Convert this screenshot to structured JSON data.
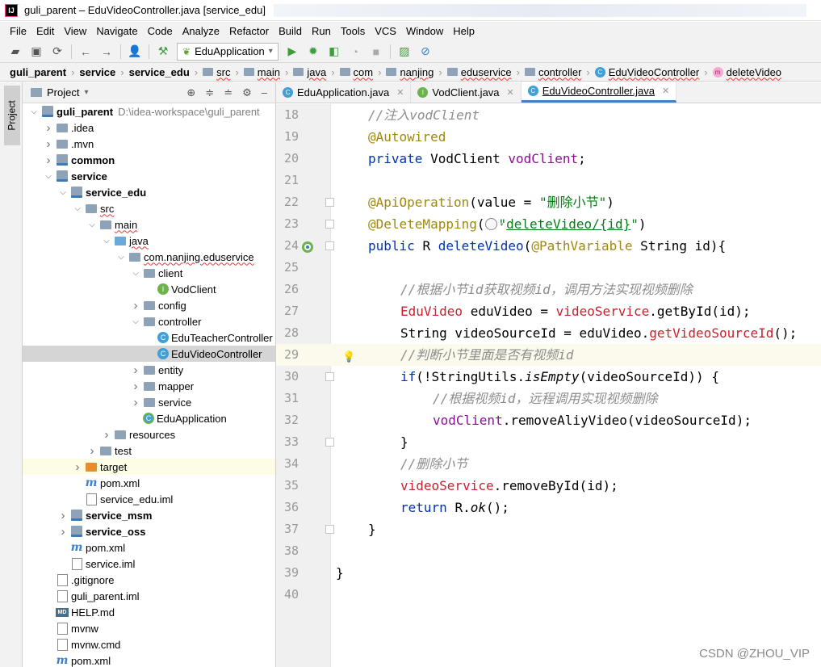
{
  "window": {
    "title": "guli_parent – EduVideoController.java [service_edu]",
    "app_icon": "IJ"
  },
  "menu": [
    "File",
    "Edit",
    "View",
    "Navigate",
    "Code",
    "Analyze",
    "Refactor",
    "Build",
    "Run",
    "Tools",
    "VCS",
    "Window",
    "Help"
  ],
  "toolbar": {
    "run_config": "EduApplication",
    "icons": [
      "open-folder-icon",
      "save-icon",
      "sync-icon",
      "back-icon",
      "forward-icon",
      "user-icon",
      "build-hammer-icon",
      "run-icon",
      "debug-icon",
      "coverage-icon",
      "profile-icon",
      "stop-icon",
      "monitor-icon",
      "no-entry-icon"
    ]
  },
  "breadcrumb": [
    {
      "label": "guli_parent",
      "bold": true
    },
    {
      "label": "service",
      "bold": true
    },
    {
      "label": "service_edu",
      "bold": true
    },
    {
      "label": "src"
    },
    {
      "label": "main"
    },
    {
      "label": "java"
    },
    {
      "label": "com"
    },
    {
      "label": "nanjing"
    },
    {
      "label": "eduservice"
    },
    {
      "label": "controller"
    },
    {
      "label": "EduVideoController",
      "icon": "class"
    },
    {
      "label": "deleteVideo",
      "icon": "method"
    }
  ],
  "side_stripe": {
    "tab": "Project"
  },
  "project_panel": {
    "title": "Project",
    "tree": [
      {
        "label": "guli_parent",
        "path": "D:\\idea-workspace\\guli_parent",
        "depth": 0,
        "arrow": "open",
        "icon": "module",
        "bold": true
      },
      {
        "label": ".idea",
        "depth": 1,
        "arrow": "closed",
        "icon": "folder"
      },
      {
        "label": ".mvn",
        "depth": 1,
        "arrow": "closed",
        "icon": "folder"
      },
      {
        "label": "common",
        "depth": 1,
        "arrow": "closed",
        "icon": "module",
        "bold": true
      },
      {
        "label": "service",
        "depth": 1,
        "arrow": "open",
        "icon": "module",
        "bold": true
      },
      {
        "label": "service_edu",
        "depth": 2,
        "arrow": "open",
        "icon": "module",
        "bold": true
      },
      {
        "label": "src",
        "depth": 3,
        "arrow": "open",
        "icon": "folder"
      },
      {
        "label": "main",
        "depth": 4,
        "arrow": "open",
        "icon": "folder"
      },
      {
        "label": "java",
        "depth": 5,
        "arrow": "open",
        "icon": "folder-blue"
      },
      {
        "label": "com.nanjing.eduservice",
        "depth": 6,
        "arrow": "open",
        "icon": "folder"
      },
      {
        "label": "client",
        "depth": 7,
        "arrow": "open",
        "icon": "folder"
      },
      {
        "label": "VodClient",
        "depth": 8,
        "arrow": "none",
        "icon": "i-class"
      },
      {
        "label": "config",
        "depth": 7,
        "arrow": "closed",
        "icon": "folder"
      },
      {
        "label": "controller",
        "depth": 7,
        "arrow": "open",
        "icon": "folder"
      },
      {
        "label": "EduTeacherController",
        "depth": 8,
        "arrow": "none",
        "icon": "c-class"
      },
      {
        "label": "EduVideoController",
        "depth": 8,
        "arrow": "none",
        "icon": "c-class",
        "selected": true
      },
      {
        "label": "entity",
        "depth": 7,
        "arrow": "closed",
        "icon": "folder"
      },
      {
        "label": "mapper",
        "depth": 7,
        "arrow": "closed",
        "icon": "folder"
      },
      {
        "label": "service",
        "depth": 7,
        "arrow": "closed",
        "icon": "folder"
      },
      {
        "label": "EduApplication",
        "depth": 7,
        "arrow": "none",
        "icon": "boot"
      },
      {
        "label": "resources",
        "depth": 5,
        "arrow": "closed",
        "icon": "folder"
      },
      {
        "label": "test",
        "depth": 4,
        "arrow": "closed",
        "icon": "folder"
      },
      {
        "label": "target",
        "depth": 3,
        "arrow": "closed",
        "icon": "folder-orange",
        "highlight": true
      },
      {
        "label": "pom.xml",
        "depth": 3,
        "arrow": "none",
        "icon": "maven"
      },
      {
        "label": "service_edu.iml",
        "depth": 3,
        "arrow": "none",
        "icon": "file"
      },
      {
        "label": "service_msm",
        "depth": 2,
        "arrow": "closed",
        "icon": "module",
        "bold": true
      },
      {
        "label": "service_oss",
        "depth": 2,
        "arrow": "closed",
        "icon": "module",
        "bold": true
      },
      {
        "label": "pom.xml",
        "depth": 2,
        "arrow": "none",
        "icon": "maven"
      },
      {
        "label": "service.iml",
        "depth": 2,
        "arrow": "none",
        "icon": "file"
      },
      {
        "label": ".gitignore",
        "depth": 1,
        "arrow": "none",
        "icon": "file"
      },
      {
        "label": "guli_parent.iml",
        "depth": 1,
        "arrow": "none",
        "icon": "file"
      },
      {
        "label": "HELP.md",
        "depth": 1,
        "arrow": "none",
        "icon": "md"
      },
      {
        "label": "mvnw",
        "depth": 1,
        "arrow": "none",
        "icon": "file"
      },
      {
        "label": "mvnw.cmd",
        "depth": 1,
        "arrow": "none",
        "icon": "file"
      },
      {
        "label": "pom.xml",
        "depth": 1,
        "arrow": "none",
        "icon": "maven"
      }
    ]
  },
  "editor_tabs": [
    {
      "label": "EduApplication.java",
      "icon": "class",
      "active": false
    },
    {
      "label": "VodClient.java",
      "icon": "interface",
      "active": false
    },
    {
      "label": "EduVideoController.java",
      "icon": "class",
      "active": true
    }
  ],
  "editor": {
    "current_line": 29,
    "lines": [
      {
        "n": "18",
        "indent": 1,
        "tokens": [
          {
            "t": "//注入vodClient",
            "c": "cmt"
          }
        ]
      },
      {
        "n": "19",
        "indent": 1,
        "tokens": [
          {
            "t": "@Autowired",
            "c": "ann"
          }
        ]
      },
      {
        "n": "20",
        "indent": 1,
        "tokens": [
          {
            "t": "private ",
            "c": "kw"
          },
          {
            "t": "VodClient "
          },
          {
            "t": "vodClient",
            "c": "fld"
          },
          {
            "t": ";"
          }
        ]
      },
      {
        "n": "21",
        "indent": 0,
        "tokens": []
      },
      {
        "n": "22",
        "indent": 1,
        "mark": true,
        "tokens": [
          {
            "t": "@ApiOperation",
            "c": "ann"
          },
          {
            "t": "(value = "
          },
          {
            "t": "\"删除小节\"",
            "c": "str"
          },
          {
            "t": ")"
          }
        ]
      },
      {
        "n": "23",
        "indent": 1,
        "mark": true,
        "globe": true,
        "tokens": [
          {
            "t": "@DeleteMapping",
            "c": "ann"
          },
          {
            "t": "(",
            "g": true
          },
          {
            "t": "\"",
            "c": "str"
          },
          {
            "t": "deleteVideo/{id}",
            "c": "str link"
          },
          {
            "t": "\"",
            "c": "str"
          },
          {
            "t": ")"
          }
        ]
      },
      {
        "n": "24",
        "indent": 1,
        "mark": true,
        "gicon": true,
        "tokens": [
          {
            "t": "public ",
            "c": "kw"
          },
          {
            "t": "R "
          },
          {
            "t": "deleteVideo",
            "c": "kw"
          },
          {
            "t": "("
          },
          {
            "t": "@PathVariable",
            "c": "ann"
          },
          {
            "t": " String id){"
          }
        ]
      },
      {
        "n": "25",
        "indent": 0,
        "tokens": []
      },
      {
        "n": "26",
        "indent": 2,
        "tokens": [
          {
            "t": "//根据小节id获取视频id，调用方法实现视频删除",
            "c": "cmt"
          }
        ]
      },
      {
        "n": "27",
        "indent": 2,
        "tokens": [
          {
            "t": "EduVideo ",
            "c": "red"
          },
          {
            "t": "eduVideo = "
          },
          {
            "t": "videoService",
            "c": "red"
          },
          {
            "t": ".getById(id);"
          }
        ]
      },
      {
        "n": "28",
        "indent": 2,
        "tokens": [
          {
            "t": "String videoSourceId = eduVideo."
          },
          {
            "t": "getVideoSourceId",
            "c": "red"
          },
          {
            "t": "();"
          }
        ]
      },
      {
        "n": "29",
        "indent": 2,
        "bulb": true,
        "tokens": [
          {
            "t": "//判断小节里面是否有视频id",
            "c": "cmt"
          }
        ]
      },
      {
        "n": "30",
        "indent": 2,
        "mark": true,
        "tokens": [
          {
            "t": "if",
            "c": "kw"
          },
          {
            "t": "(!StringUtils."
          },
          {
            "t": "isEmpty",
            "c": "ital"
          },
          {
            "t": "(videoSourceId)) {"
          }
        ]
      },
      {
        "n": "31",
        "indent": 3,
        "tokens": [
          {
            "t": "//根据视频id，远程调用实现视频删除",
            "c": "cmt"
          }
        ]
      },
      {
        "n": "32",
        "indent": 3,
        "tokens": [
          {
            "t": "vodClient",
            "c": "fld"
          },
          {
            "t": ".removeAliyVideo(videoSourceId);"
          }
        ]
      },
      {
        "n": "33",
        "indent": 2,
        "mark": true,
        "tokens": [
          {
            "t": "}"
          }
        ]
      },
      {
        "n": "34",
        "indent": 2,
        "tokens": [
          {
            "t": "//删除小节",
            "c": "cmt"
          }
        ]
      },
      {
        "n": "35",
        "indent": 2,
        "tokens": [
          {
            "t": "videoService",
            "c": "red"
          },
          {
            "t": ".removeById(id);"
          }
        ]
      },
      {
        "n": "36",
        "indent": 2,
        "tokens": [
          {
            "t": "return ",
            "c": "kw"
          },
          {
            "t": "R."
          },
          {
            "t": "ok",
            "c": "ital"
          },
          {
            "t": "();"
          }
        ]
      },
      {
        "n": "37",
        "indent": 1,
        "mark": true,
        "tokens": [
          {
            "t": "}"
          }
        ]
      },
      {
        "n": "38",
        "indent": 0,
        "tokens": []
      },
      {
        "n": "39",
        "indent": 0,
        "tokens": [
          {
            "t": "}"
          }
        ]
      },
      {
        "n": "40",
        "indent": 0,
        "tokens": []
      }
    ]
  },
  "watermark": "CSDN @ZHOU_VIP"
}
